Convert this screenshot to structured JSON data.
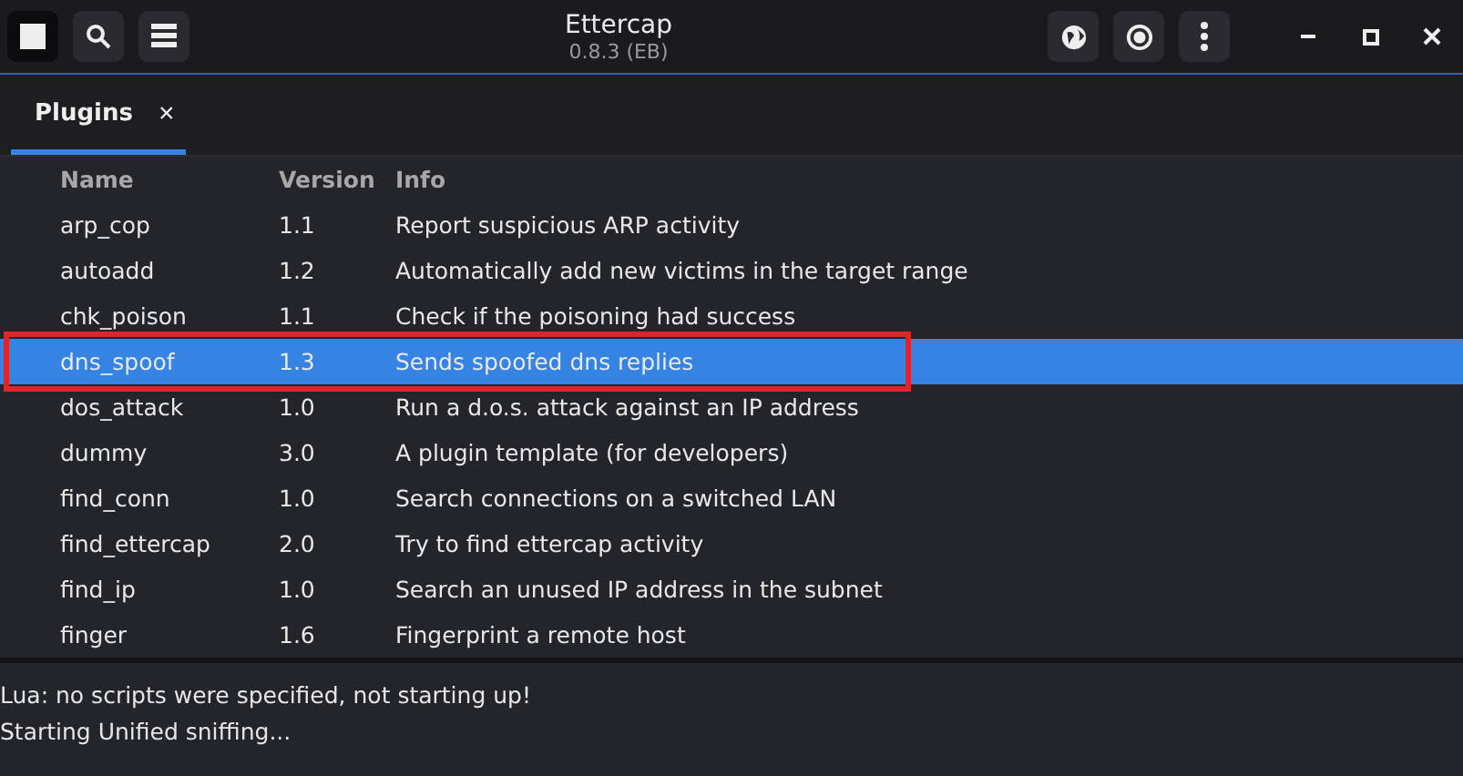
{
  "window": {
    "title": "Ettercap",
    "subtitle": "0.8.3 (EB)"
  },
  "tabs": [
    {
      "label": "Plugins",
      "selected": true,
      "close": "×"
    }
  ],
  "table": {
    "columns": [
      "Name",
      "Version",
      "Info"
    ],
    "rows": [
      {
        "name": "arp_cop",
        "version": "1.1",
        "info": "Report suspicious ARP activity",
        "selected": false,
        "highlighted": false
      },
      {
        "name": "autoadd",
        "version": "1.2",
        "info": "Automatically add new victims in the target range",
        "selected": false,
        "highlighted": false
      },
      {
        "name": "chk_poison",
        "version": "1.1",
        "info": "Check if the poisoning had success",
        "selected": false,
        "highlighted": false
      },
      {
        "name": "dns_spoof",
        "version": "1.3",
        "info": "Sends spoofed dns replies",
        "selected": true,
        "highlighted": true
      },
      {
        "name": "dos_attack",
        "version": "1.0",
        "info": "Run a d.o.s. attack against an IP address",
        "selected": false,
        "highlighted": false
      },
      {
        "name": "dummy",
        "version": "3.0",
        "info": "A plugin template (for developers)",
        "selected": false,
        "highlighted": false
      },
      {
        "name": "find_conn",
        "version": "1.0",
        "info": "Search connections on a switched LAN",
        "selected": false,
        "highlighted": false
      },
      {
        "name": "find_ettercap",
        "version": "2.0",
        "info": "Try to find ettercap activity",
        "selected": false,
        "highlighted": false
      },
      {
        "name": "find_ip",
        "version": "1.0",
        "info": "Search an unused IP address in the subnet",
        "selected": false,
        "highlighted": false
      },
      {
        "name": "finger",
        "version": "1.6",
        "info": "Fingerprint a remote host",
        "selected": false,
        "highlighted": false
      }
    ]
  },
  "log": [
    "Lua: no scripts were specified, not starting up!",
    "Starting Unified sniffing..."
  ]
}
